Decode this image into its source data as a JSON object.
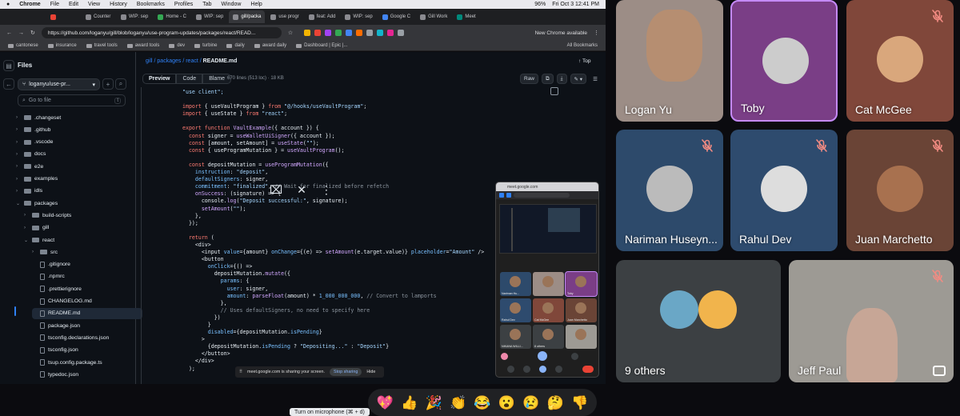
{
  "menubar": {
    "app": "Chrome",
    "items": [
      "File",
      "Edit",
      "View",
      "History",
      "Bookmarks",
      "Profiles",
      "Tab",
      "Window",
      "Help"
    ],
    "battery": "96%",
    "datetime": "Fri Oct 3  12:41 PM"
  },
  "tabs": [
    {
      "label": "",
      "color": "#ea4335"
    },
    {
      "label": "Counter",
      "color": "#8a8a90"
    },
    {
      "label": "WIP: sep",
      "color": "#8a8a90"
    },
    {
      "label": "Home - C",
      "color": "#34a853"
    },
    {
      "label": "WIP: sep",
      "color": "#8a8a90"
    },
    {
      "label": "gill/packa",
      "color": "#8a8a90"
    },
    {
      "label": "use progr",
      "color": "#8a8a90"
    },
    {
      "label": "feat: Add",
      "color": "#8a8a90"
    },
    {
      "label": "WIP: sep",
      "color": "#8a8a90"
    },
    {
      "label": "Google C",
      "color": "#4285f4"
    },
    {
      "label": "Gill Work",
      "color": "#8a8a90"
    },
    {
      "label": "Meet",
      "color": "#00897b"
    }
  ],
  "address": {
    "url": "https://github.com/loganyu/gill/blob/loganyu/use-program-updates/packages/react/READ...",
    "new_chrome": "New Chrome available"
  },
  "bookmarks": [
    "cantonese",
    "insurance",
    "travel tools",
    "award tools",
    "dev",
    "turbine",
    "daily",
    "award daily",
    "Dashboard | Epic |..."
  ],
  "bookmarks_all": "All Bookmarks",
  "github": {
    "files_title": "Files",
    "branch": "loganyu/use-pr...",
    "goto_placeholder": "Go to file",
    "goto_key": "t",
    "tree": [
      {
        "label": ".changeset",
        "kind": "folder",
        "depth": 0
      },
      {
        "label": ".github",
        "kind": "folder",
        "depth": 0
      },
      {
        "label": ".vscode",
        "kind": "folder",
        "depth": 0
      },
      {
        "label": "docs",
        "kind": "folder",
        "depth": 0
      },
      {
        "label": "e2e",
        "kind": "folder",
        "depth": 0
      },
      {
        "label": "examples",
        "kind": "folder",
        "depth": 0
      },
      {
        "label": "idls",
        "kind": "folder",
        "depth": 0
      },
      {
        "label": "packages",
        "kind": "folder-open",
        "depth": 0
      },
      {
        "label": "build-scripts",
        "kind": "folder",
        "depth": 1
      },
      {
        "label": "gill",
        "kind": "folder",
        "depth": 1
      },
      {
        "label": "react",
        "kind": "folder-open",
        "depth": 1
      },
      {
        "label": "src",
        "kind": "folder",
        "depth": 2
      },
      {
        "label": ".gitignore",
        "kind": "file",
        "depth": 2
      },
      {
        "label": ".npmrc",
        "kind": "file",
        "depth": 2
      },
      {
        "label": ".prettierignore",
        "kind": "file",
        "depth": 2
      },
      {
        "label": "CHANGELOG.md",
        "kind": "file",
        "depth": 2
      },
      {
        "label": "README.md",
        "kind": "file",
        "depth": 2,
        "selected": true
      },
      {
        "label": "package.json",
        "kind": "file",
        "depth": 2
      },
      {
        "label": "tsconfig.declarations.json",
        "kind": "file",
        "depth": 2
      },
      {
        "label": "tsconfig.json",
        "kind": "file",
        "depth": 2
      },
      {
        "label": "tsup.config.package.ts",
        "kind": "file",
        "depth": 2
      },
      {
        "label": "typedoc.json",
        "kind": "file",
        "depth": 2
      }
    ],
    "breadcrumb": {
      "p1": "gill",
      "p2": "packages",
      "p3": "react",
      "file": "README.md"
    },
    "top_link": "Top",
    "view_tabs": [
      "Preview",
      "Code",
      "Blame"
    ],
    "line_info": "670 lines (513 loc) · 18 KB",
    "raw_label": "Raw",
    "code_lines": [
      [
        [
          "str",
          "\"use client\";"
        ]
      ],
      [],
      [
        [
          "kw",
          "import"
        ],
        [
          "pl",
          " { useVaultProgram } "
        ],
        [
          "kw",
          "from"
        ],
        [
          "str",
          " \"@/hooks/useVaultProgram\""
        ],
        [
          "pl",
          ";"
        ]
      ],
      [
        [
          "kw",
          "import"
        ],
        [
          "pl",
          " { useState } "
        ],
        [
          "kw",
          "from"
        ],
        [
          "str",
          " \"react\""
        ],
        [
          "pl",
          ";"
        ]
      ],
      [],
      [
        [
          "kw",
          "export function"
        ],
        [
          "fn",
          " VaultExample"
        ],
        [
          "pl",
          "({ account }) {"
        ]
      ],
      [
        [
          "kw",
          "  const"
        ],
        [
          "pl",
          " signer = "
        ],
        [
          "fn",
          "useWalletUiSigner"
        ],
        [
          "pl",
          "({ account });"
        ]
      ],
      [
        [
          "kw",
          "  const"
        ],
        [
          "pl",
          " [amount, setAmount] = "
        ],
        [
          "fn",
          "useState"
        ],
        [
          "pl",
          "("
        ],
        [
          "str",
          "\"\""
        ],
        [
          "pl",
          ");"
        ]
      ],
      [
        [
          "kw",
          "  const"
        ],
        [
          "pl",
          " { useProgramMutation } = "
        ],
        [
          "fn",
          "useVaultProgram"
        ],
        [
          "pl",
          "();"
        ]
      ],
      [],
      [
        [
          "kw",
          "  const"
        ],
        [
          "pl",
          " depositMutation = "
        ],
        [
          "fn",
          "useProgramMutation"
        ],
        [
          "pl",
          "({"
        ]
      ],
      [
        [
          "vr",
          "    instruction"
        ],
        [
          "pl",
          ": "
        ],
        [
          "str",
          "\"deposit\""
        ],
        [
          "pl",
          ","
        ]
      ],
      [
        [
          "vr",
          "    defaultSigners"
        ],
        [
          "pl",
          ": signer,"
        ]
      ],
      [
        [
          "vr",
          "    commitment"
        ],
        [
          "pl",
          ": "
        ],
        [
          "str",
          "\"finalized\""
        ],
        [
          "pl",
          ", "
        ],
        [
          "cm",
          "// Wait for finalized before refetch"
        ]
      ],
      [
        [
          "fn",
          "    onSuccess"
        ],
        [
          "pl",
          ": (signature) => {"
        ]
      ],
      [
        [
          "pl",
          "      console."
        ],
        [
          "fn",
          "log"
        ],
        [
          "pl",
          "("
        ],
        [
          "str",
          "\"Deposit successful:\""
        ],
        [
          "pl",
          ", signature);"
        ]
      ],
      [
        [
          "fn",
          "      setAmount"
        ],
        [
          "pl",
          "("
        ],
        [
          "str",
          "\"\""
        ],
        [
          "pl",
          ");"
        ]
      ],
      [
        [
          "pl",
          "    },"
        ]
      ],
      [
        [
          "pl",
          "  });"
        ]
      ],
      [],
      [
        [
          "kw",
          "  return"
        ],
        [
          "pl",
          " ("
        ]
      ],
      [
        [
          "pl",
          "    <div>"
        ]
      ],
      [
        [
          "pl",
          "      <input "
        ],
        [
          "vr",
          "value"
        ],
        [
          "pl",
          "={amount} "
        ],
        [
          "vr",
          "onChange"
        ],
        [
          "pl",
          "={(e) => "
        ],
        [
          "fn",
          "setAmount"
        ],
        [
          "pl",
          "(e.target.value)} "
        ],
        [
          "vr",
          "placeholder"
        ],
        [
          "pl",
          "="
        ],
        [
          "str",
          "\"Amount\""
        ],
        [
          "pl",
          " />"
        ]
      ],
      [
        [
          "pl",
          "      <button"
        ]
      ],
      [
        [
          "vr",
          "        onClick"
        ],
        [
          "pl",
          "={() =>"
        ]
      ],
      [
        [
          "pl",
          "          depositMutation."
        ],
        [
          "fn",
          "mutate"
        ],
        [
          "pl",
          "({"
        ]
      ],
      [
        [
          "vr",
          "            params"
        ],
        [
          "pl",
          ": {"
        ]
      ],
      [
        [
          "vr",
          "              user"
        ],
        [
          "pl",
          ": signer,"
        ]
      ],
      [
        [
          "vr",
          "              amount"
        ],
        [
          "pl",
          ": "
        ],
        [
          "fn",
          "parseFloat"
        ],
        [
          "pl",
          "(amount) * "
        ],
        [
          "vr",
          "1_000_000_000"
        ],
        [
          "pl",
          ", "
        ],
        [
          "cm",
          "// Convert to lamports"
        ]
      ],
      [
        [
          "pl",
          "            },"
        ]
      ],
      [
        [
          "cm",
          "            // Uses defaultSigners, no need to specify here"
        ]
      ],
      [
        [
          "pl",
          "          })"
        ]
      ],
      [
        [
          "pl",
          "        }"
        ]
      ],
      [
        [
          "vr",
          "        disabled"
        ],
        [
          "pl",
          "={depositMutation."
        ],
        [
          "vr",
          "isPending"
        ],
        [
          "pl",
          "}"
        ]
      ],
      [
        [
          "pl",
          "      >"
        ]
      ],
      [
        [
          "pl",
          "        {depositMutation."
        ],
        [
          "vr",
          "isPending"
        ],
        [
          "pl",
          " ? "
        ],
        [
          "str",
          "\"Depositing...\""
        ],
        [
          "pl",
          " : "
        ],
        [
          "str",
          "\"Deposit\""
        ],
        [
          "pl",
          "}"
        ]
      ],
      [
        [
          "pl",
          "      </button>"
        ]
      ],
      [
        [
          "pl",
          "    </div>"
        ]
      ],
      [
        [
          "pl",
          "  );"
        ]
      ]
    ]
  },
  "mini_meet": {
    "url": "meet.google.com",
    "tiles": [
      "Nariman Hu...",
      "",
      "Toby",
      "Rahul Dev",
      "Cat McGee",
      "Juan Marchetto",
      "NIKANA WILLI...",
      "8 others",
      ""
    ]
  },
  "share_banner": {
    "text": "meet.google.com is sharing your screen.",
    "stop": "Stop sharing",
    "hide": "Hide"
  },
  "meet": {
    "participants": [
      {
        "name": "Logan Yu",
        "muted": false,
        "bg": "#9c8d86"
      },
      {
        "name": "Toby",
        "muted": false,
        "bg": "#7a3e86",
        "highlight": "#c58af9"
      },
      {
        "name": "Cat McGee",
        "muted": true,
        "bg": "#80473a"
      },
      {
        "name": "Nariman Huseyn...",
        "muted": true,
        "bg": "#2d4a6b"
      },
      {
        "name": "Rahul Dev",
        "muted": true,
        "bg": "#2e4b6e"
      },
      {
        "name": "Juan Marchetto",
        "muted": true,
        "bg": "#6a4436"
      },
      {
        "name": "9 others",
        "muted": false,
        "bg": "#3c4043"
      },
      {
        "name": "Jeff Paul",
        "muted": true,
        "bg": "#9d9a94"
      }
    ],
    "reactions": [
      "💖",
      "👍",
      "🎉",
      "👏",
      "😂",
      "😮",
      "😢",
      "🤔",
      "👎"
    ],
    "tooltip": "Turn on microphone (⌘ + d)"
  }
}
